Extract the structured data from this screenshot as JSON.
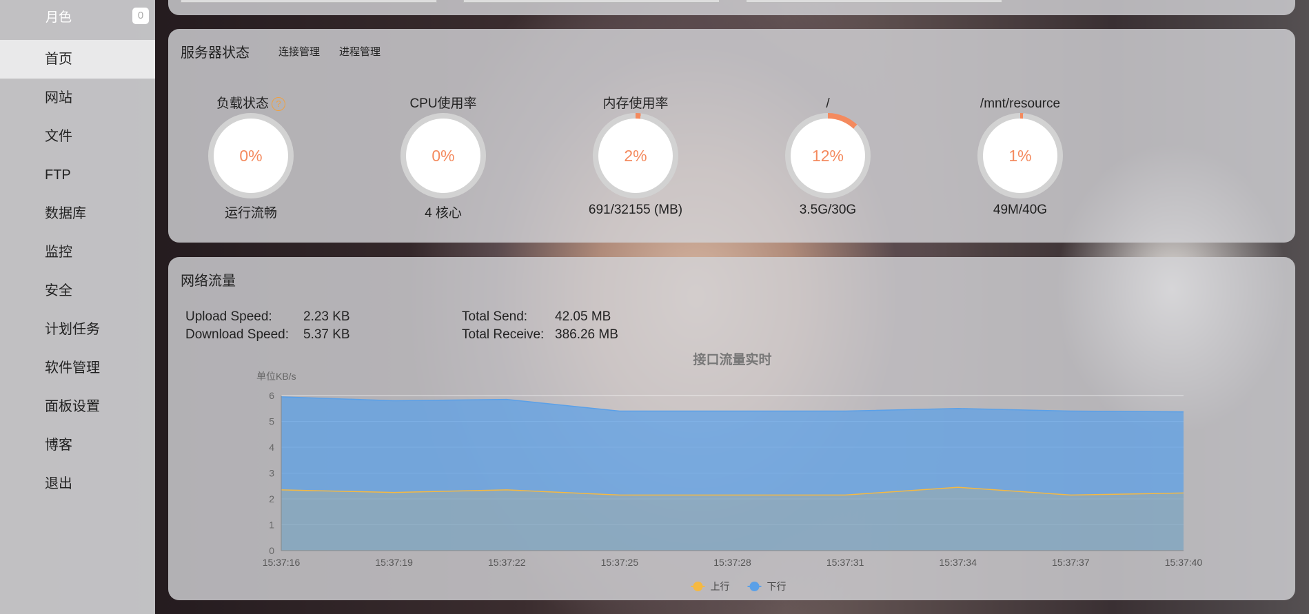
{
  "sidebar": {
    "user": {
      "name": "月色",
      "badge": "0"
    },
    "items": [
      {
        "label": "首页",
        "active": true
      },
      {
        "label": "网站"
      },
      {
        "label": "文件"
      },
      {
        "label": "FTP"
      },
      {
        "label": "数据库"
      },
      {
        "label": "监控"
      },
      {
        "label": "安全"
      },
      {
        "label": "计划任务"
      },
      {
        "label": "软件管理"
      },
      {
        "label": "面板设置"
      },
      {
        "label": "博客"
      },
      {
        "label": "退出"
      }
    ]
  },
  "server": {
    "title": "服务器状态",
    "tabs": [
      "连接管理",
      "进程管理"
    ],
    "gauges": [
      {
        "label": "负载状态",
        "value": "0%",
        "percent": 0,
        "sub": "运行流畅",
        "help": "?"
      },
      {
        "label": "CPU使用率",
        "value": "0%",
        "percent": 0,
        "sub": "4 核心"
      },
      {
        "label": "内存使用率",
        "value": "2%",
        "percent": 2,
        "sub": "691/32155 (MB)"
      },
      {
        "label": "/",
        "value": "12%",
        "percent": 12,
        "sub": "3.5G/30G"
      },
      {
        "label": "/mnt/resource",
        "value": "1%",
        "percent": 1,
        "sub": "49M/40G"
      }
    ]
  },
  "network": {
    "title": "网络流量",
    "upload_label": "Upload Speed:",
    "upload_value": "2.23 KB",
    "download_label": "Download Speed:",
    "download_value": "5.37 KB",
    "send_label": "Total Send:",
    "send_value": "42.05 MB",
    "receive_label": "Total Receive:",
    "receive_value": "386.26 MB"
  },
  "colors": {
    "accent": "#f48a5e",
    "upload": "#f5b942",
    "download": "#5aa0e8"
  },
  "chart_data": {
    "type": "area",
    "title": "接口流量实时",
    "ylabel": "单位KB/s",
    "ylim": [
      0,
      6
    ],
    "yticks": [
      "0",
      "1",
      "2",
      "3",
      "4",
      "5",
      "6"
    ],
    "x": [
      "15:37:16",
      "15:37:19",
      "15:37:22",
      "15:37:25",
      "15:37:28",
      "15:37:31",
      "15:37:34",
      "15:37:37",
      "15:37:40"
    ],
    "legend": "bottom-center",
    "series": [
      {
        "name": "上行",
        "color": "#f5b942",
        "values": [
          2.35,
          2.25,
          2.35,
          2.15,
          2.15,
          2.15,
          2.45,
          2.15,
          2.23
        ]
      },
      {
        "name": "下行",
        "color": "#5aa0e8",
        "values": [
          5.95,
          5.8,
          5.85,
          5.4,
          5.4,
          5.4,
          5.5,
          5.4,
          5.37
        ]
      }
    ]
  }
}
